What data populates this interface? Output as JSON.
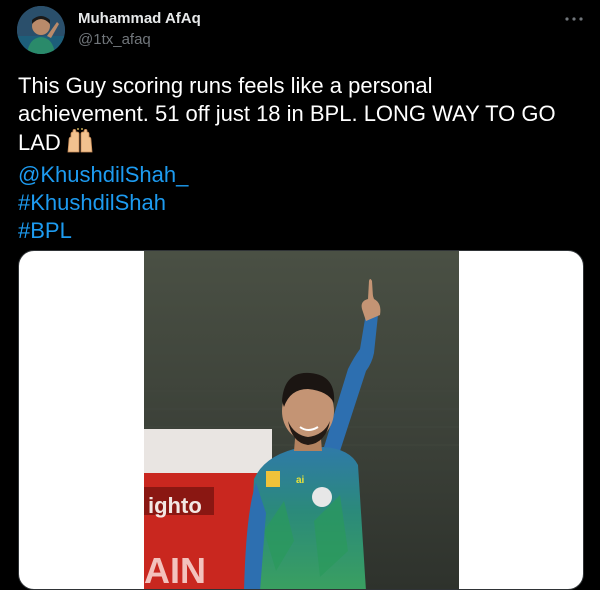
{
  "author": {
    "display_name": "Muhammad AfAq",
    "handle": "@1tx_afaq"
  },
  "tweet": {
    "text_lines": [
      "This Guy scoring runs feels like a personal",
      "achievement. 51 off just 18 in BPL. LONG WAY TO GO",
      "LAD"
    ],
    "emoji": "raising-hands-emoji",
    "mention": "@KhushdilShah_",
    "hashtags": [
      "#KhushdilShah",
      "#BPL"
    ]
  },
  "media": {
    "image": "cricketer-celebrating-photo",
    "background_sign_text": [
      "ighto",
      "AIN"
    ]
  },
  "icons": {
    "more": "more-options-icon"
  },
  "colors": {
    "background": "#000000",
    "text": "#ffffff",
    "secondary": "#71767b",
    "link": "#1d9bf0"
  }
}
